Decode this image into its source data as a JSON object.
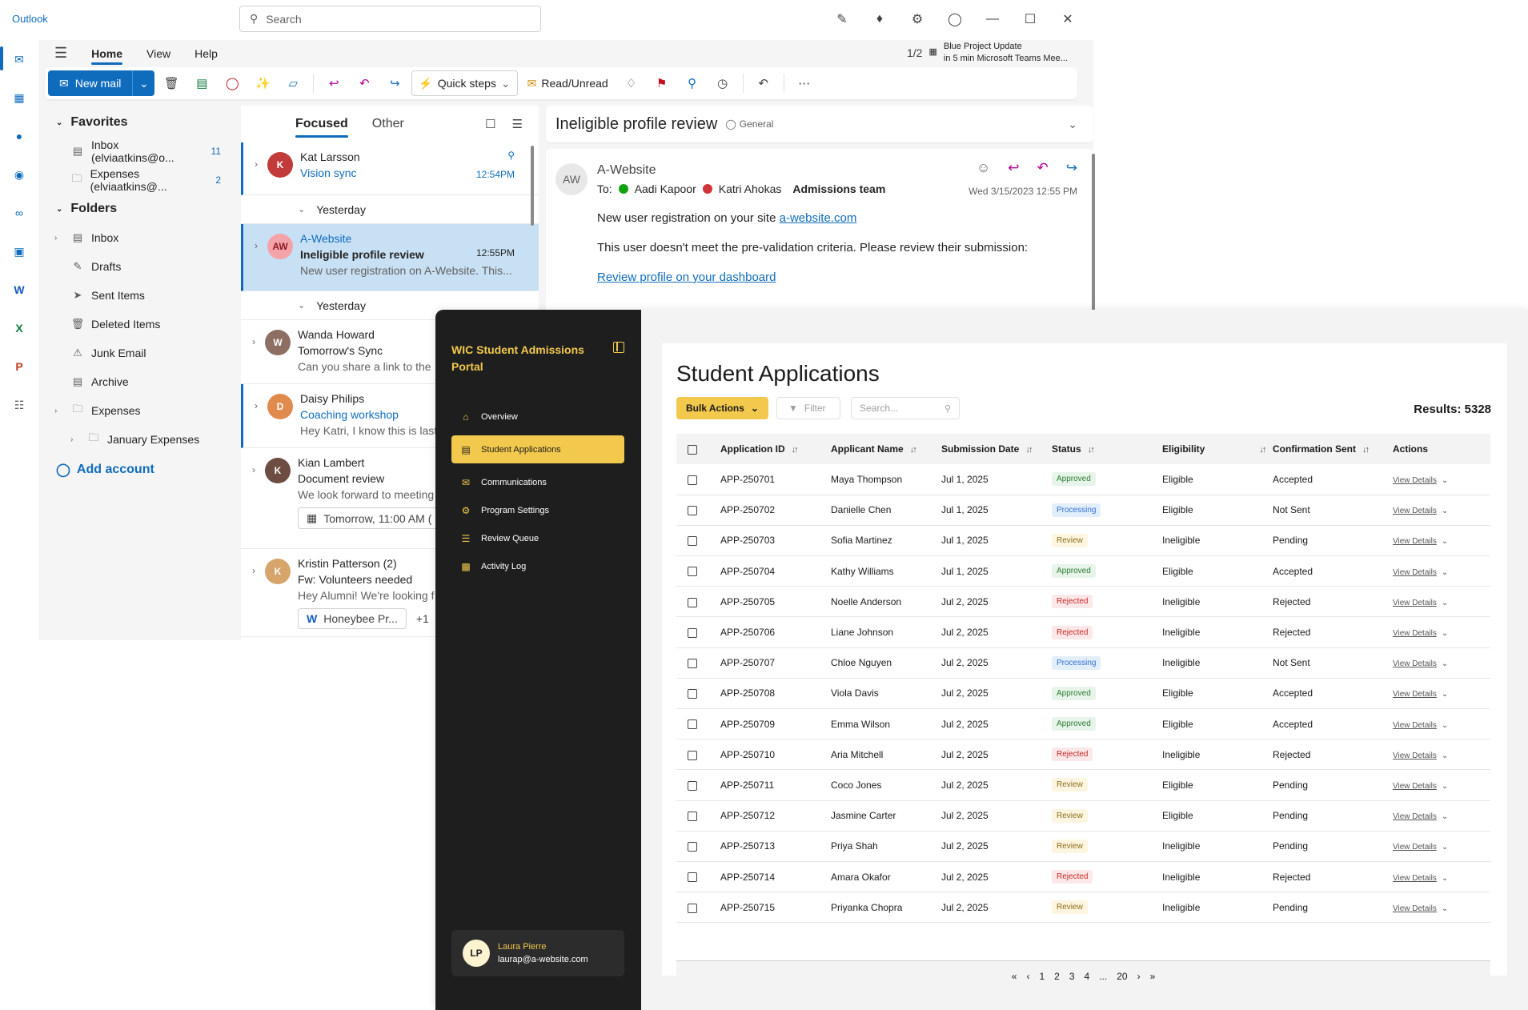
{
  "outlook": {
    "brand": "Outlook",
    "search_placeholder": "Search",
    "tabs": [
      "Home",
      "View",
      "Help"
    ],
    "reminder": {
      "page": "1/2",
      "title": "Blue Project Update",
      "detail": "in 5 min Microsoft Teams Mee..."
    },
    "ribbon": {
      "new_mail": "New mail",
      "quick_steps": "Quick steps",
      "read_unread": "Read/Unread"
    },
    "favorites": {
      "heading": "Favorites",
      "items": [
        {
          "label": "Inbox (elviaatkins@o...",
          "count": "11"
        },
        {
          "label": "Expenses (elviaatkins@...",
          "count": "2"
        }
      ]
    },
    "folders": {
      "heading": "Folders",
      "items": [
        "Inbox",
        "Drafts",
        "Sent Items",
        "Deleted Items",
        "Junk Email",
        "Archive",
        "Expenses",
        "January Expenses"
      ]
    },
    "add_account": "Add account",
    "list_tabs": {
      "focused": "Focused",
      "other": "Other"
    },
    "messages": [
      {
        "from": "Kat Larsson",
        "subject": "Vision sync",
        "time": "12:54PM"
      },
      {
        "group": "Yesterday"
      },
      {
        "from": "A-Website",
        "subject": "Ineligible profile review",
        "time": "12:55PM",
        "preview": "New user registration on A-Website. This...",
        "initials": "AW"
      },
      {
        "group": "Yesterday"
      },
      {
        "from": "Wanda Howard",
        "subject": "Tomorrow's Sync",
        "preview": "Can you share a link to the"
      },
      {
        "from": "Daisy Philips",
        "subject": "Coaching workshop",
        "preview": "Hey Katri, I know this is last"
      },
      {
        "from": "Kian Lambert",
        "subject": "Document review",
        "preview": "We look forward to meeting",
        "chip": "Tomorrow, 11:00 AM ("
      },
      {
        "from": "Kristin Patterson (2)",
        "subject": "Fw: Volunteers needed",
        "preview": "Hey Alumni! We're looking f",
        "chip": "Honeybee Pr...",
        "extra": "+1"
      }
    ],
    "reading": {
      "title": "Ineligible profile review",
      "label": "General",
      "from": "A-Website",
      "initials": "AW",
      "to_label": "To:",
      "recipients": [
        "Aadi Kapoor",
        "Katri Ahokas"
      ],
      "team": "Admissions team",
      "date": "Wed 3/15/2023 12:55 PM",
      "line1": "New user registration on your site ",
      "line1_link": "a-website.com",
      "line2": "This user doesn't meet the pre-validation criteria. Please review their submission:",
      "link": "Review profile on your dashboard"
    }
  },
  "portal": {
    "title": "WIC Student Admissions Portal",
    "nav": [
      "Overview",
      "Student Applications",
      "Communications",
      "Program Settings",
      "Review Queue",
      "Activity Log"
    ],
    "user": {
      "initials": "LP",
      "name": "Laura Pierre",
      "email": "laurap@a-website.com"
    },
    "heading": "Student Applications",
    "bulk_actions": "Bulk Actions",
    "filter": "Filter",
    "search_placeholder": "Search...",
    "results": "Results: 5328",
    "columns": [
      "Application ID",
      "Applicant Name",
      "Submission Date",
      "Status",
      "Eligibility",
      "Confirmation Sent",
      "Actions"
    ],
    "view_details": "View Details",
    "rows": [
      {
        "id": "APP-250701",
        "name": "Maya Thompson",
        "date": "Jul 1, 2025",
        "status": "Approved",
        "elig": "Eligible",
        "conf": "Accepted"
      },
      {
        "id": "APP-250702",
        "name": "Danielle Chen",
        "date": "Jul 1, 2025",
        "status": "Processing",
        "elig": "Eligible",
        "conf": "Not Sent"
      },
      {
        "id": "APP-250703",
        "name": "Sofia Martinez",
        "date": "Jul 1, 2025",
        "status": "Review",
        "elig": "Ineligible",
        "conf": "Pending"
      },
      {
        "id": "APP-250704",
        "name": "Kathy Williams",
        "date": "Jul 1, 2025",
        "status": "Approved",
        "elig": "Eligible",
        "conf": "Accepted"
      },
      {
        "id": "APP-250705",
        "name": "Noelle Anderson",
        "date": "Jul 2, 2025",
        "status": "Rejected",
        "elig": "Ineligible",
        "conf": "Rejected"
      },
      {
        "id": "APP-250706",
        "name": "Liane Johnson",
        "date": "Jul 2, 2025",
        "status": "Rejected",
        "elig": "Ineligible",
        "conf": "Rejected"
      },
      {
        "id": "APP-250707",
        "name": "Chloe Nguyen",
        "date": "Jul 2, 2025",
        "status": "Processing",
        "elig": "Ineligible",
        "conf": "Not Sent"
      },
      {
        "id": "APP-250708",
        "name": "Viola Davis",
        "date": "Jul 2, 2025",
        "status": "Approved",
        "elig": "Eligible",
        "conf": "Accepted"
      },
      {
        "id": "APP-250709",
        "name": "Emma Wilson",
        "date": "Jul 2, 2025",
        "status": "Approved",
        "elig": "Eligible",
        "conf": "Accepted"
      },
      {
        "id": "APP-250710",
        "name": "Aria Mitchell",
        "date": "Jul 2, 2025",
        "status": "Rejected",
        "elig": "Ineligible",
        "conf": "Rejected"
      },
      {
        "id": "APP-250711",
        "name": "Coco Jones",
        "date": "Jul 2, 2025",
        "status": "Review",
        "elig": "Eligible",
        "conf": "Pending"
      },
      {
        "id": "APP-250712",
        "name": "Jasmine Carter",
        "date": "Jul 2, 2025",
        "status": "Review",
        "elig": "Eligible",
        "conf": "Pending"
      },
      {
        "id": "APP-250713",
        "name": "Priya Shah",
        "date": "Jul 2, 2025",
        "status": "Review",
        "elig": "Ineligible",
        "conf": "Pending"
      },
      {
        "id": "APP-250714",
        "name": "Amara Okafor",
        "date": "Jul 2, 2025",
        "status": "Rejected",
        "elig": "Ineligible",
        "conf": "Rejected"
      },
      {
        "id": "APP-250715",
        "name": "Priyanka Chopra",
        "date": "Jul 2, 2025",
        "status": "Review",
        "elig": "Ineligible",
        "conf": "Pending"
      }
    ],
    "pager": {
      "first": "«",
      "prev": "‹",
      "pages": [
        "1",
        "2",
        "3",
        "4"
      ],
      "ellipsis": "...",
      "last_page": "20",
      "next": "›",
      "last": "»"
    }
  }
}
